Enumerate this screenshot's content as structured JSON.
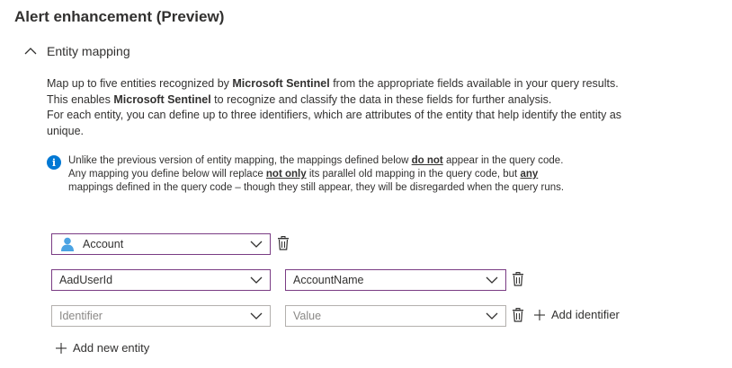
{
  "section": {
    "title": "Alert enhancement (Preview)"
  },
  "entity_mapping": {
    "header_label": "Entity mapping",
    "description": [
      {
        "pre": "Map up to five entities recognized by ",
        "bold": "Microsoft Sentinel",
        "post": " from the appropriate fields available in your query results."
      },
      {
        "pre": "This enables ",
        "bold": "Microsoft Sentinel",
        "post": " to recognize and classify the data in these fields for further analysis."
      },
      {
        "pre": "For each entity, you can define up to three identifiers, which are attributes of the entity that help identify the entity as unique.",
        "bold": "",
        "post": ""
      }
    ],
    "info": {
      "line1_pre": "Unlike the previous version of entity mapping, the mappings defined below ",
      "line1_em": "do not",
      "line1_post": " appear in the query code.",
      "line2_pre": "Any mapping you define below will replace ",
      "line2_em": "not only",
      "line2_mid": " its parallel old mapping in the query code, but ",
      "line2_em2": "any",
      "line3": "mappings defined in the query code – though they still appear, they will be disregarded when the query runs."
    },
    "entity_type": {
      "value": "Account",
      "icon": "person-icon"
    },
    "rows": [
      {
        "identifier": "AadUserId",
        "value": "AccountName"
      },
      {
        "identifier_placeholder": "Identifier",
        "value_placeholder": "Value"
      }
    ],
    "add_identifier_label": "Add identifier",
    "add_entity_label": "Add new entity"
  },
  "colors": {
    "accent_border": "#7a3c84",
    "info_blue": "#0078d4",
    "person_blue": "#4ba3e3"
  }
}
